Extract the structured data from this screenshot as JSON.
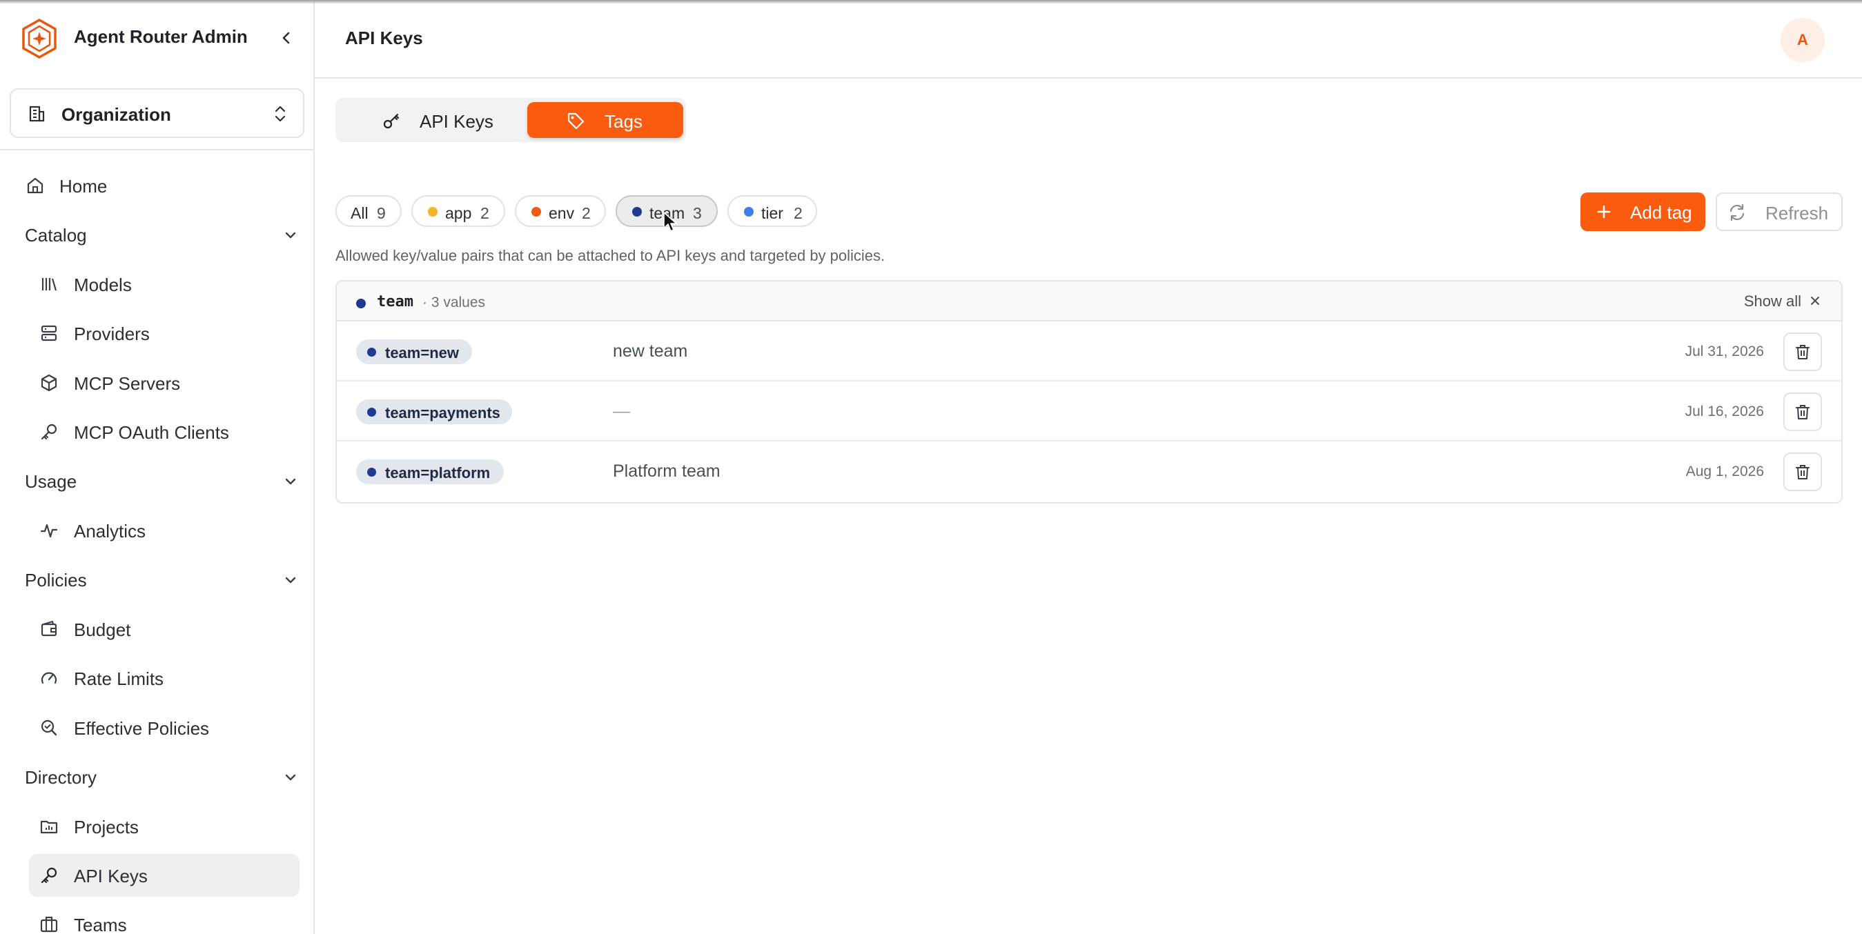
{
  "app": {
    "title": "Agent Router Admin",
    "accent_color": "#fa5b0f"
  },
  "org": {
    "label": "Organization"
  },
  "sidebar": {
    "home": "Home",
    "catalog": {
      "label": "Catalog",
      "items": [
        "Models",
        "Providers",
        "MCP Servers",
        "MCP OAuth Clients"
      ]
    },
    "usage": {
      "label": "Usage",
      "items": [
        "Analytics"
      ]
    },
    "policies": {
      "label": "Policies",
      "items": [
        "Budget",
        "Rate Limits",
        "Effective Policies"
      ]
    },
    "directory": {
      "label": "Directory",
      "items": [
        "Projects",
        "API Keys",
        "Teams"
      ]
    },
    "active_item": "API Keys"
  },
  "header": {
    "title": "API Keys",
    "avatar_initial": "A"
  },
  "tabs": [
    {
      "label": "API Keys",
      "icon": "key-icon",
      "selected": false
    },
    {
      "label": "Tags",
      "icon": "tag-icon",
      "selected": true
    }
  ],
  "filters": [
    {
      "name": "All",
      "count": "9",
      "color": null,
      "selected": false
    },
    {
      "name": "app",
      "count": "2",
      "color": "#f2b52a",
      "selected": false
    },
    {
      "name": "env",
      "count": "2",
      "color": "#ee5a0e",
      "selected": false
    },
    {
      "name": "team",
      "count": "3",
      "color": "#1f3a8f",
      "selected": true
    },
    {
      "name": "tier",
      "count": "2",
      "color": "#3f7fe8",
      "selected": false
    }
  ],
  "actions": {
    "add_tag": "Add tag",
    "refresh": "Refresh"
  },
  "description": "Allowed key/value pairs that can be attached to API keys and targeted by policies.",
  "table": {
    "group_key": "team",
    "group_meta": "· 3 values",
    "show_all": "Show all",
    "rows": [
      {
        "tag": "team=new",
        "description": "new team",
        "date": "Jul 31, 2026"
      },
      {
        "tag": "team=payments",
        "description": "—",
        "date": "Jul 16, 2026"
      },
      {
        "tag": "team=platform",
        "description": "Platform team",
        "date": "Aug 1, 2026"
      }
    ]
  }
}
